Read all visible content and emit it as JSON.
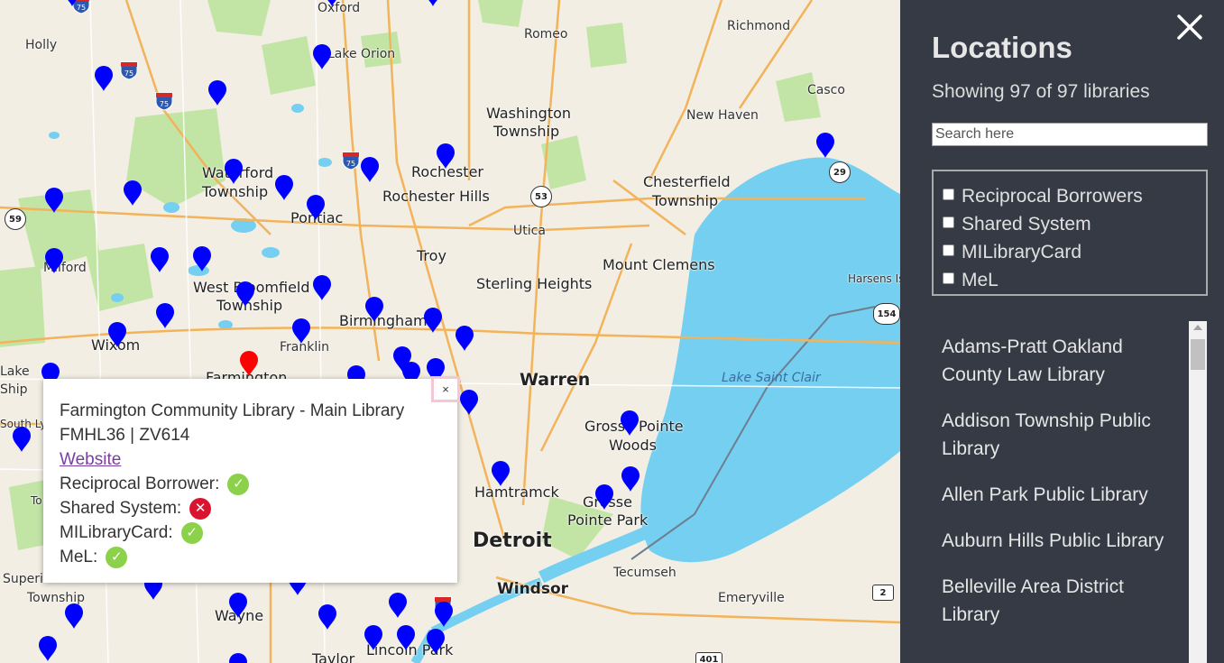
{
  "map": {
    "places": [
      {
        "name": "Holly",
        "cls": ""
      },
      {
        "name": "Oxford",
        "cls": ""
      },
      {
        "name": "Lake Orion",
        "cls": ""
      },
      {
        "name": "Romeo",
        "cls": ""
      },
      {
        "name": "Richmond",
        "cls": ""
      },
      {
        "name": "Casco",
        "cls": ""
      },
      {
        "name": "New Haven",
        "cls": ""
      },
      {
        "name": "Washington",
        "cls": "big"
      },
      {
        "name": "Township",
        "cls": "big"
      },
      {
        "name": "Waterford",
        "cls": "big"
      },
      {
        "name": "Township",
        "cls": "big"
      },
      {
        "name": "Rochester",
        "cls": "big"
      },
      {
        "name": "Rochester Hills",
        "cls": "big"
      },
      {
        "name": "Chesterfield",
        "cls": "big"
      },
      {
        "name": "Township",
        "cls": "big"
      },
      {
        "name": "Pontiac",
        "cls": "big"
      },
      {
        "name": "Utica",
        "cls": ""
      },
      {
        "name": "Milford",
        "cls": ""
      },
      {
        "name": "Troy",
        "cls": "big"
      },
      {
        "name": "Mount Clemens",
        "cls": "big"
      },
      {
        "name": "Sterling Heights",
        "cls": "big"
      },
      {
        "name": "West Bloomfield",
        "cls": "big"
      },
      {
        "name": "Township",
        "cls": "big"
      },
      {
        "name": "Harsens Is",
        "cls": ""
      },
      {
        "name": "Birmingham",
        "cls": "big"
      },
      {
        "name": "Wixom",
        "cls": "big"
      },
      {
        "name": "Franklin",
        "cls": ""
      },
      {
        "name": "Farmington",
        "cls": "big"
      },
      {
        "name": "Warren",
        "cls": "city"
      },
      {
        "name": "Lake Saint Clair",
        "cls": "water"
      },
      {
        "name": "Grosse Pointe",
        "cls": "big"
      },
      {
        "name": "Woods",
        "cls": "big"
      },
      {
        "name": "Hamtramck",
        "cls": "big"
      },
      {
        "name": "Grosse",
        "cls": "big"
      },
      {
        "name": "Pointe Park",
        "cls": "big"
      },
      {
        "name": "Detroit",
        "cls": "city"
      },
      {
        "name": "Tecumseh",
        "cls": ""
      },
      {
        "name": "Windsor",
        "cls": "city"
      },
      {
        "name": "Emeryville",
        "cls": ""
      },
      {
        "name": "Superior Charter",
        "cls": ""
      },
      {
        "name": "Township",
        "cls": ""
      },
      {
        "name": "Wayne",
        "cls": "big"
      },
      {
        "name": "Lincoln Park",
        "cls": "big"
      },
      {
        "name": "Taylor",
        "cls": "big"
      },
      {
        "name": "South Lyon",
        "cls": ""
      },
      {
        "name": "Lake",
        "cls": ""
      },
      {
        "name": "Ship",
        "cls": ""
      },
      {
        "name": "To",
        "cls": ""
      }
    ],
    "shields": [
      "59",
      "53",
      "29",
      "154",
      "2",
      "401"
    ],
    "interstates": [
      "75",
      "75",
      "75",
      "75"
    ],
    "colors": {
      "pin": "#0000ff",
      "pin_selected": "#ff0000",
      "water": "#75cff0",
      "park": "#c2e5a5"
    }
  },
  "popup": {
    "close": "×",
    "title": "Farmington Community Library - Main Library",
    "codes": "FMHL36 | ZV614",
    "website": "Website",
    "rows": [
      {
        "label": "Reciprocal Borrower:",
        "status": "yes",
        "glyph": "✓"
      },
      {
        "label": "Shared System:",
        "status": "no",
        "glyph": "✕"
      },
      {
        "label": "MILibraryCard:",
        "status": "yes",
        "glyph": "✓"
      },
      {
        "label": "MeL:",
        "status": "yes",
        "glyph": "✓"
      }
    ]
  },
  "sidebar": {
    "title": "Locations",
    "count": "Showing 97 of 97 libraries",
    "search_placeholder": "Search here",
    "filters": [
      "Reciprocal Borrowers",
      "Shared System",
      "MILibraryCard",
      "MeL"
    ],
    "libraries": [
      "Adams-Pratt Oakland County Law Library",
      "Addison Township Public Library",
      "Allen Park Public Library",
      "Auburn Hills Public Library",
      "Belleville Area District Library"
    ]
  }
}
